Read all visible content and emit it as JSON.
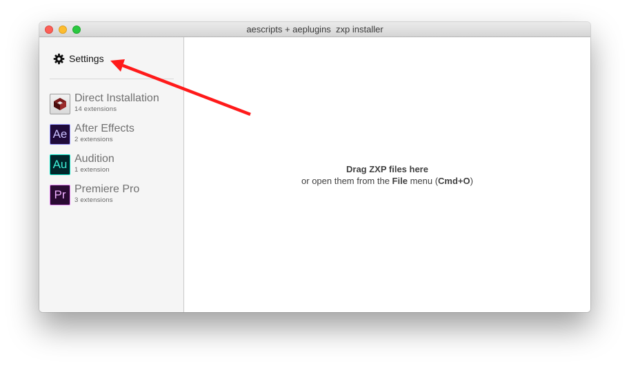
{
  "window": {
    "title": "aescripts + aeplugins  zxp installer"
  },
  "sidebar": {
    "settings_label": "Settings",
    "items": [
      {
        "name": "Direct Installation",
        "count": "14 extensions",
        "icon": "direct-installation-icon",
        "glyph": ""
      },
      {
        "name": "After Effects",
        "count": "2 extensions",
        "icon": "after-effects-icon",
        "glyph": "Ae"
      },
      {
        "name": "Audition",
        "count": "1 extension",
        "icon": "audition-icon",
        "glyph": "Au"
      },
      {
        "name": "Premiere Pro",
        "count": "3 extensions",
        "icon": "premiere-pro-icon",
        "glyph": "Pr"
      }
    ]
  },
  "main": {
    "drop_title": "Drag ZXP files here",
    "drop_prefix": "or open them from the ",
    "drop_menu": "File",
    "drop_middle": " menu (",
    "drop_shortcut": "Cmd+O",
    "drop_suffix": ")"
  },
  "annotation": {
    "arrow_color": "#ff1a1a"
  },
  "colors": {
    "close": "#fc5f57",
    "minimize": "#fdbc2e",
    "zoom": "#2ac840",
    "after_effects": "#9999ff",
    "audition": "#00e0c4",
    "premiere_pro": "#e07df0"
  }
}
